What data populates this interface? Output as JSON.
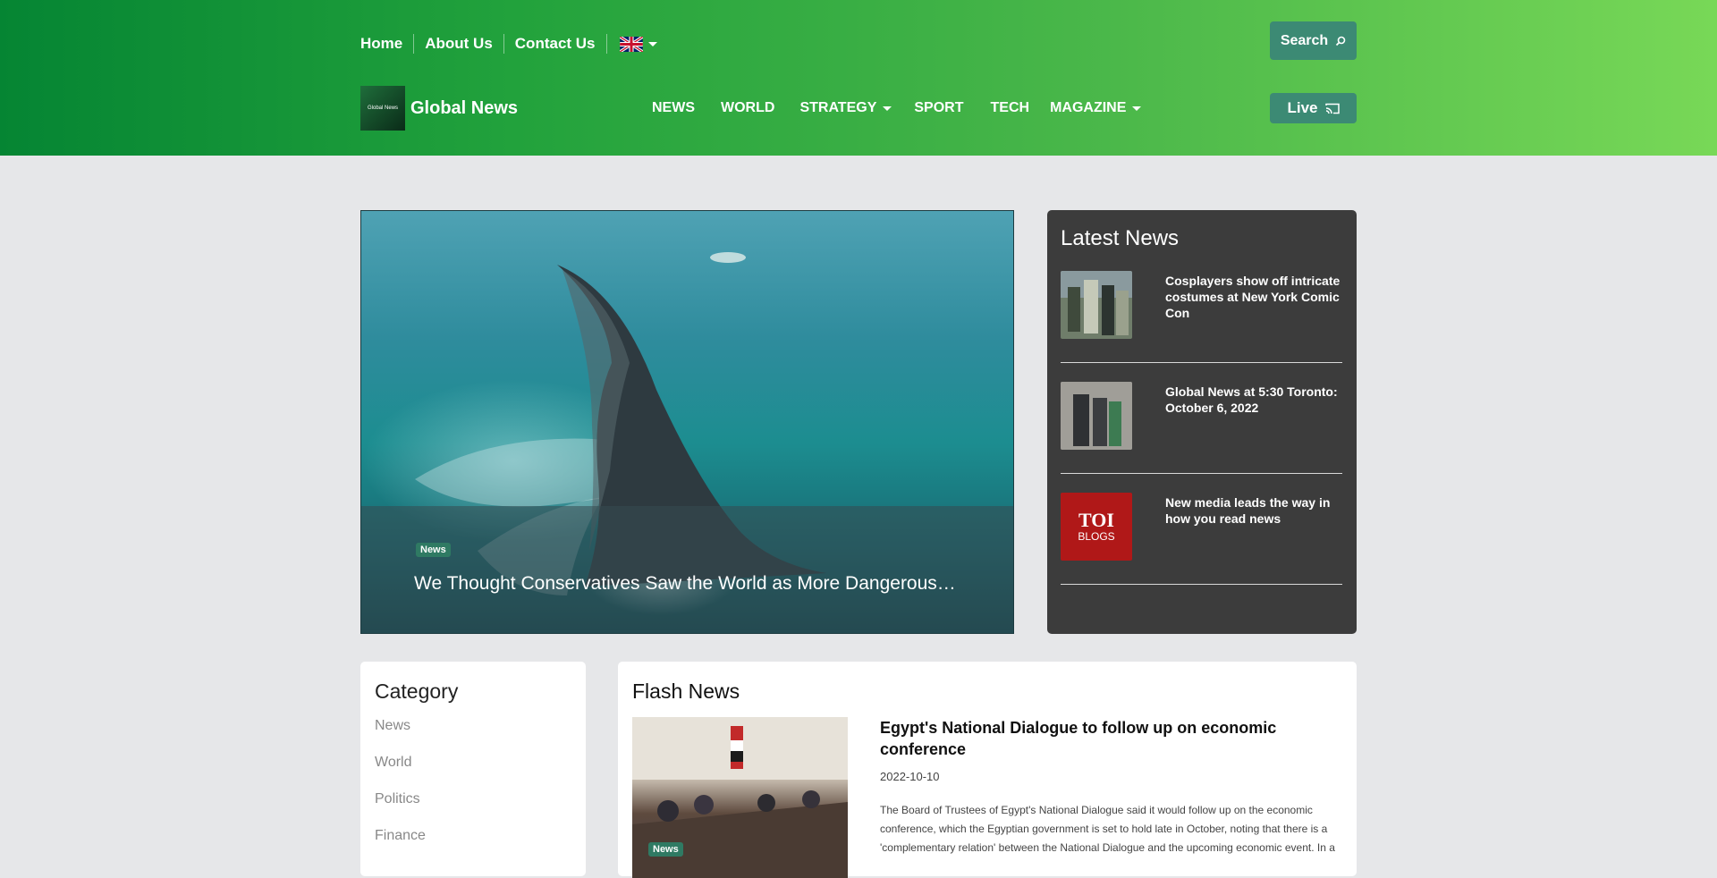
{
  "topnav": {
    "items": [
      "Home",
      "About Us",
      "Contact Us"
    ],
    "language": "English"
  },
  "search": {
    "label": "Search",
    "icon": "search-icon"
  },
  "live": {
    "label": "Live",
    "icon": "cast-icon"
  },
  "brand": {
    "logo_text": "Global News",
    "name": "Global News"
  },
  "mainnav": {
    "items": [
      {
        "label": "NEWS",
        "dropdown": false
      },
      {
        "label": "WORLD",
        "dropdown": false
      },
      {
        "label": "STRATEGY",
        "dropdown": true
      },
      {
        "label": "SPORT",
        "dropdown": false
      },
      {
        "label": "TECH",
        "dropdown": false
      },
      {
        "label": "MAGAZINE",
        "dropdown": true
      }
    ]
  },
  "hero": {
    "badge": "News",
    "title": "We Thought Conservatives Saw the World as More Dangerous. Maybe Not"
  },
  "latest": {
    "heading": "Latest News",
    "items": [
      {
        "title": "Cosplayers show off intricate costumes at New York Comic Con"
      },
      {
        "title": "Global News at 5:30 Toronto: October 6, 2022"
      },
      {
        "title": "New media leads the way in how you read news",
        "thumb_line1": "TOI",
        "thumb_line2": "BLOGS"
      }
    ]
  },
  "category": {
    "heading": "Category",
    "items": [
      "News",
      "World",
      "Politics",
      "Finance"
    ]
  },
  "flash": {
    "heading": "Flash News",
    "badge": "News",
    "title": "Egypt's National Dialogue to follow up on economic conference",
    "date": "2022-10-10",
    "description": "The Board of Trustees of Egypt's National Dialogue said it would follow up on the economic conference, which the Egyptian government is set to hold late in October, noting that there is a 'complementary relation' between the National Dialogue and the upcoming economic event. In a"
  },
  "colors": {
    "header_start": "#058533",
    "header_end": "#78d857",
    "button": "#3c8a74",
    "badge": "#2f7a63",
    "latest_panel": "#3c3c3c"
  }
}
